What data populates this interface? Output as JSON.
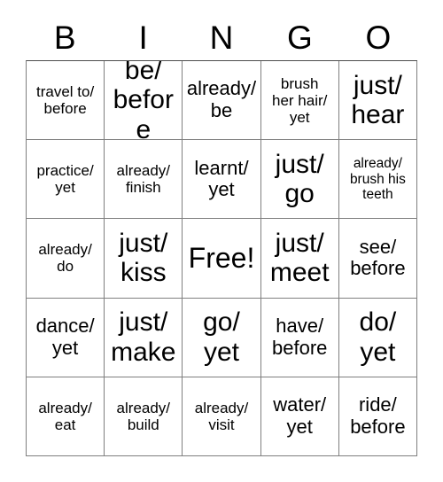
{
  "header": {
    "letters": [
      "B",
      "I",
      "N",
      "G",
      "O"
    ]
  },
  "grid": {
    "rows": 5,
    "columns": 5,
    "free_space_label": "Free!",
    "text_color": "#000000",
    "background_color": "#ffffff",
    "border_color": "#7f7f7f",
    "cells": [
      {
        "text": "travel to/\nbefore",
        "size": "sm"
      },
      {
        "text": "be/\nbefore",
        "size": "lg"
      },
      {
        "text": "already/\nbe",
        "size": "md"
      },
      {
        "text": "brush\nher hair/\nyet",
        "size": "sm"
      },
      {
        "text": "just/\nhear",
        "size": "lg"
      },
      {
        "text": "practice/\nyet",
        "size": "sm"
      },
      {
        "text": "already/\nfinish",
        "size": "sm"
      },
      {
        "text": "learnt/\nyet",
        "size": "md"
      },
      {
        "text": "just/\ngo",
        "size": "lg"
      },
      {
        "text": "already/\nbrush his\nteeth",
        "size": "xs"
      },
      {
        "text": "already/\ndo",
        "size": "sm"
      },
      {
        "text": "just/\nkiss",
        "size": "lg"
      },
      {
        "text": "Free!",
        "size": "xl"
      },
      {
        "text": "just/\nmeet",
        "size": "lg"
      },
      {
        "text": "see/\nbefore",
        "size": "md"
      },
      {
        "text": "dance/\nyet",
        "size": "md"
      },
      {
        "text": "just/\nmake",
        "size": "lg"
      },
      {
        "text": "go/\nyet",
        "size": "lg"
      },
      {
        "text": "have/\nbefore",
        "size": "md"
      },
      {
        "text": "do/\nyet",
        "size": "lg"
      },
      {
        "text": "already/\neat",
        "size": "sm"
      },
      {
        "text": "already/\nbuild",
        "size": "sm"
      },
      {
        "text": "already/\nvisit",
        "size": "sm"
      },
      {
        "text": "water/\nyet",
        "size": "md"
      },
      {
        "text": "ride/\nbefore",
        "size": "md"
      }
    ]
  }
}
